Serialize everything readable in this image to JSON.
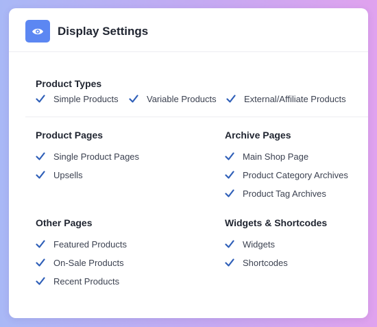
{
  "colors": {
    "accent": "#5c87f2",
    "check": "#2f5fb8"
  },
  "header": {
    "title": "Display Settings",
    "icon": "eye-icon"
  },
  "product_types": {
    "title": "Product Types",
    "items": [
      {
        "label": "Simple Products",
        "checked": true
      },
      {
        "label": "Variable Products",
        "checked": true
      },
      {
        "label": "External/Affiliate Products",
        "checked": true
      }
    ]
  },
  "product_pages": {
    "title": "Product Pages",
    "items": [
      {
        "label": "Single Product Pages",
        "checked": true
      },
      {
        "label": "Upsells",
        "checked": true
      }
    ]
  },
  "archive_pages": {
    "title": "Archive Pages",
    "items": [
      {
        "label": "Main Shop Page",
        "checked": true
      },
      {
        "label": "Product Category Archives",
        "checked": true
      },
      {
        "label": "Product Tag Archives",
        "checked": true
      }
    ]
  },
  "other_pages": {
    "title": "Other Pages",
    "items": [
      {
        "label": "Featured Products",
        "checked": true
      },
      {
        "label": "On-Sale Products",
        "checked": true
      },
      {
        "label": "Recent Products",
        "checked": true
      }
    ]
  },
  "widgets_shortcodes": {
    "title": "Widgets & Shortcodes",
    "items": [
      {
        "label": "Widgets",
        "checked": true
      },
      {
        "label": "Shortcodes",
        "checked": true
      }
    ]
  }
}
